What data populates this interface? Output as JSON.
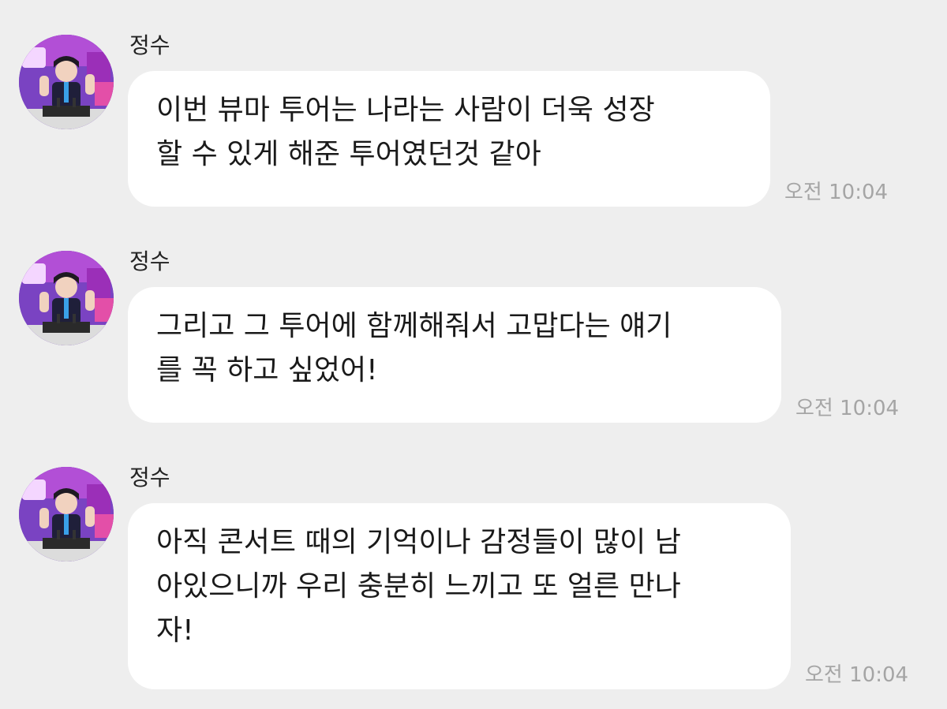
{
  "chat": {
    "messages": [
      {
        "sender": "정수",
        "lines": [
          "이번 뷰마 투어는 나라는 사람이 더욱 성장",
          "할 수 있게 해준 투어였던것 같아"
        ],
        "time": "오전 10:04"
      },
      {
        "sender": "정수",
        "lines": [
          "그리고 그 투어에 함께해줘서 고맙다는 얘기",
          "를 꼭 하고 싶었어!"
        ],
        "time": "오전 10:04"
      },
      {
        "sender": "정수",
        "lines": [
          "아직 콘서트 때의 기억이나 감정들이 많이 남",
          "아있으니까 우리 충분히 느끼고 또 얼른 만나",
          "자!"
        ],
        "time": "오전 10:04"
      }
    ]
  },
  "avatar": {
    "icon": "profile-photo-icon",
    "background_color": "#6b3fb0"
  }
}
